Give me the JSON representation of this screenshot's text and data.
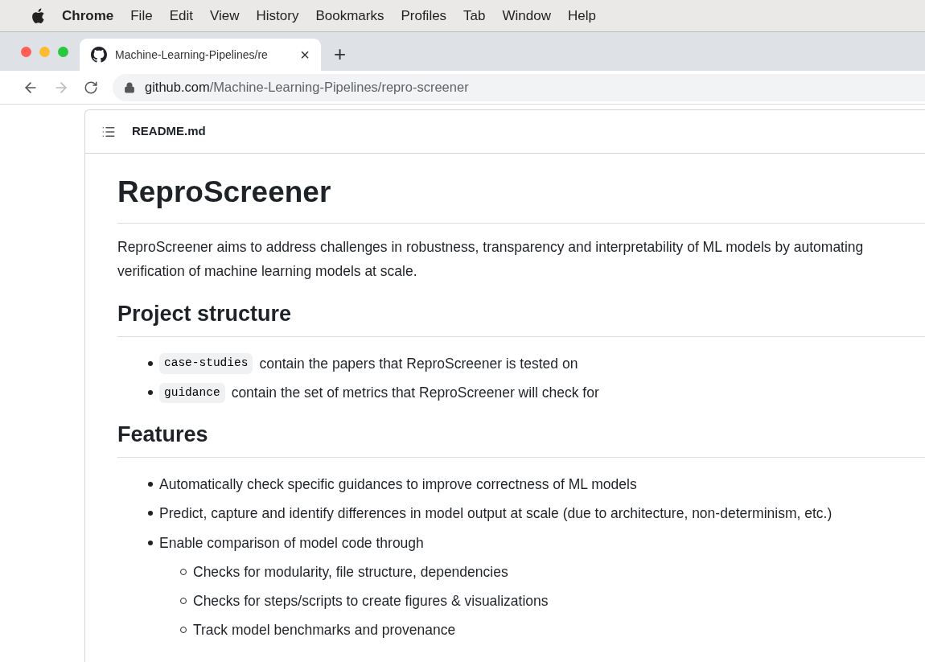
{
  "menu_bar": {
    "app": "Chrome",
    "items": [
      "File",
      "Edit",
      "View",
      "History",
      "Bookmarks",
      "Profiles",
      "Tab",
      "Window",
      "Help"
    ]
  },
  "tab": {
    "title": "Machine-Learning-Pipelines/re",
    "close": "×",
    "selected": true
  },
  "new_tab": "+",
  "address": {
    "domain": "github.com",
    "path": "/Machine-Learning-Pipelines/repro-screener"
  },
  "readme": {
    "filename": "README.md",
    "title": "ReproScreener",
    "intro": "ReproScreener aims to address challenges in robustness, transparency and interpretability of ML models by automating verification of machine learning models at scale.",
    "sections": [
      {
        "heading": "Project structure",
        "items": [
          {
            "code": "case-studies",
            "text": "contain the papers that ReproScreener is tested on"
          },
          {
            "code": "guidance",
            "text": "contain the set of metrics that ReproScreener will check for"
          }
        ]
      },
      {
        "heading": "Features",
        "items": [
          {
            "text": "Automatically check specific guidances to improve correctness of ML models"
          },
          {
            "text": "Predict, capture and identify differences in model output at scale (due to architecture, non-determinism, etc.)"
          },
          {
            "text": "Enable comparison of model code through",
            "children": [
              {
                "text": "Checks for modularity, file structure, dependencies"
              },
              {
                "text": "Checks for steps/scripts to create figures & visualizations"
              },
              {
                "text": "Track model benchmarks and provenance"
              }
            ]
          }
        ]
      }
    ]
  }
}
